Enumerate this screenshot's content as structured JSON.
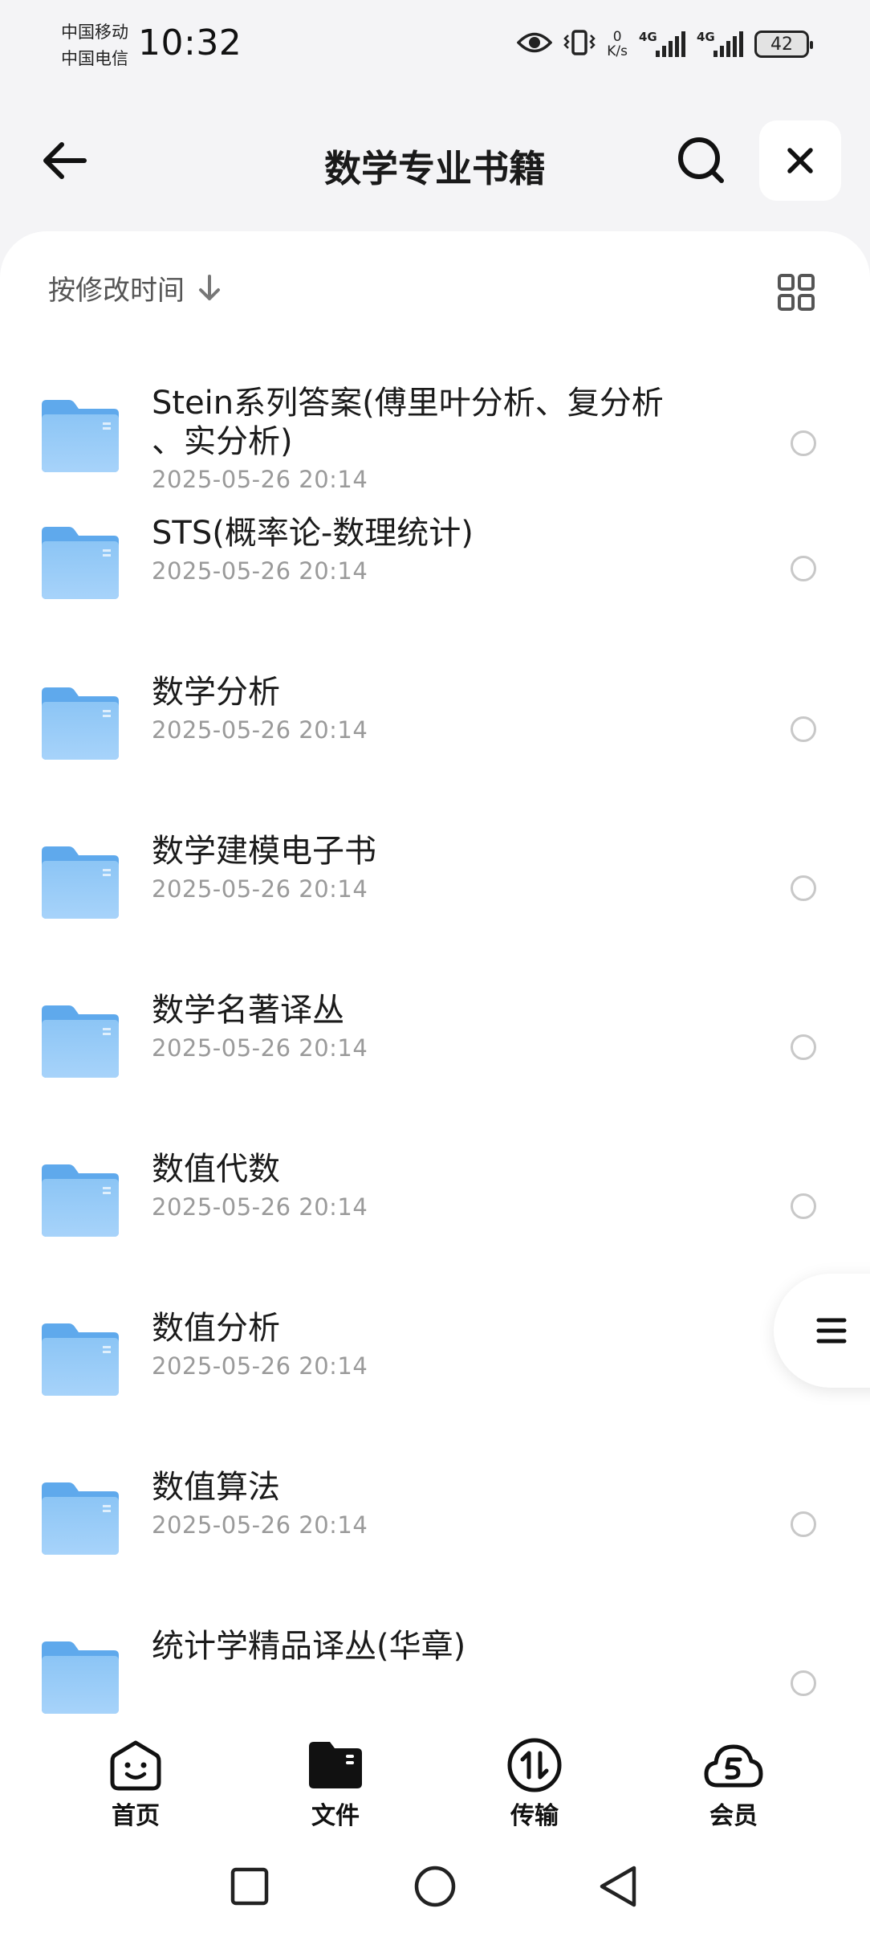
{
  "status_bar": {
    "carrier_1": "中国移动",
    "carrier_2": "中国电信",
    "time": "10:32",
    "net_speed_value": "0",
    "net_speed_unit": "K/s",
    "sim1_label": "4G",
    "sim2_label": "4G",
    "battery": "42",
    "icons": [
      "eye-icon",
      "vibrate-icon",
      "signal-icon",
      "battery-icon"
    ]
  },
  "header": {
    "title": "数学专业书籍",
    "icons": [
      "back-arrow-icon",
      "search-icon",
      "close-icon"
    ]
  },
  "sortbar": {
    "sort_label": "按修改时间",
    "icons": [
      "arrow-down-icon",
      "grid-view-icon"
    ]
  },
  "files": [
    {
      "name": "Stein系列答案(傅里叶分析、复分析、实分析)",
      "name_line1": "Stein系列答案(傅里叶分析、复分析",
      "name_line2": "、实分析)",
      "date": "2025-05-26 20:14"
    },
    {
      "name": "STS(概率论-数理统计)",
      "date": "2025-05-26 20:14"
    },
    {
      "name": "数学分析",
      "date": "2025-05-26 20:14"
    },
    {
      "name": "数学建模电子书",
      "date": "2025-05-26 20:14"
    },
    {
      "name": "数学名著译丛",
      "date": "2025-05-26 20:14"
    },
    {
      "name": "数值代数",
      "date": "2025-05-26 20:14"
    },
    {
      "name": "数值分析",
      "date": "2025-05-26 20:14"
    },
    {
      "name": "数值算法",
      "date": "2025-05-26 20:14"
    },
    {
      "name": "统计学精品译丛(华章)",
      "date": ""
    }
  ],
  "bottom_nav": [
    {
      "label": "首页",
      "icon": "home-face-icon"
    },
    {
      "label": "文件",
      "icon": "folder-icon",
      "active": true
    },
    {
      "label": "传输",
      "icon": "transfer-icon"
    },
    {
      "label": "会员",
      "icon": "vip-cloud-icon"
    }
  ],
  "colors": {
    "background": "#f4f4f6",
    "card": "#ffffff",
    "folder_blue": "#7cb8f2",
    "text_primary": "#1b1b1b",
    "text_secondary": "#9a9a9a"
  }
}
